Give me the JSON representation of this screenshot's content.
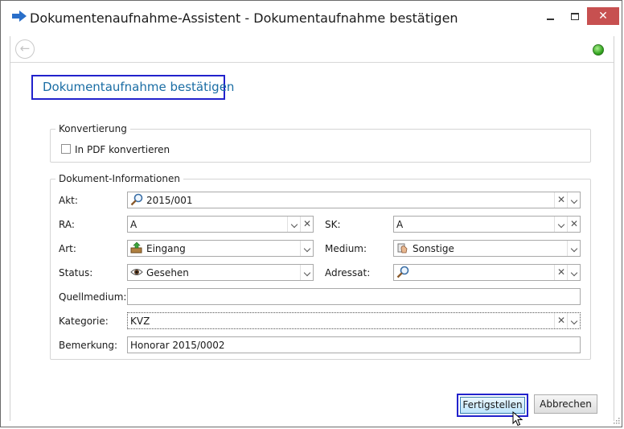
{
  "window": {
    "title": "Dokumentenaufnahme-Assistent - Dokumentaufnahme bestätigen",
    "minimize_icon": "minimize-icon",
    "maximize_icon": "maximize-icon",
    "close_icon": "close-icon",
    "close_color": "#c75050"
  },
  "nav": {
    "back_icon": "back-arrow-icon",
    "status_icon": "green-status-light",
    "status_color": "#2fa11c"
  },
  "page": {
    "heading": "Dokumentaufnahme bestätigen",
    "heading_color": "#1a6da4"
  },
  "konvertierung": {
    "legend": "Konvertierung",
    "pdf_label": "In PDF konvertieren",
    "pdf_checked": false
  },
  "dokument": {
    "legend": "Dokument-Informationen",
    "akt": {
      "label": "Akt:",
      "value": "2015/001",
      "icon": "search-icon"
    },
    "ra": {
      "label": "RA:",
      "value": "A"
    },
    "sk": {
      "label": "SK:",
      "value": "A"
    },
    "art": {
      "label": "Art:",
      "value": "Eingang",
      "icon": "inbox-icon"
    },
    "medium": {
      "label": "Medium:",
      "value": "Sonstige",
      "icon": "hand-icon"
    },
    "status": {
      "label": "Status:",
      "value": "Gesehen",
      "icon": "eye-icon"
    },
    "adressat": {
      "label": "Adressat:",
      "value": "",
      "icon": "search-icon"
    },
    "quellmedium": {
      "label": "Quellmedium:",
      "value": ""
    },
    "kategorie": {
      "label": "Kategorie:",
      "value": "KVZ"
    },
    "bemerkung": {
      "label": "Bemerkung:",
      "value": "Honorar 2015/0002"
    }
  },
  "buttons": {
    "finish": "Fertigstellen",
    "cancel": "Abbrechen"
  }
}
